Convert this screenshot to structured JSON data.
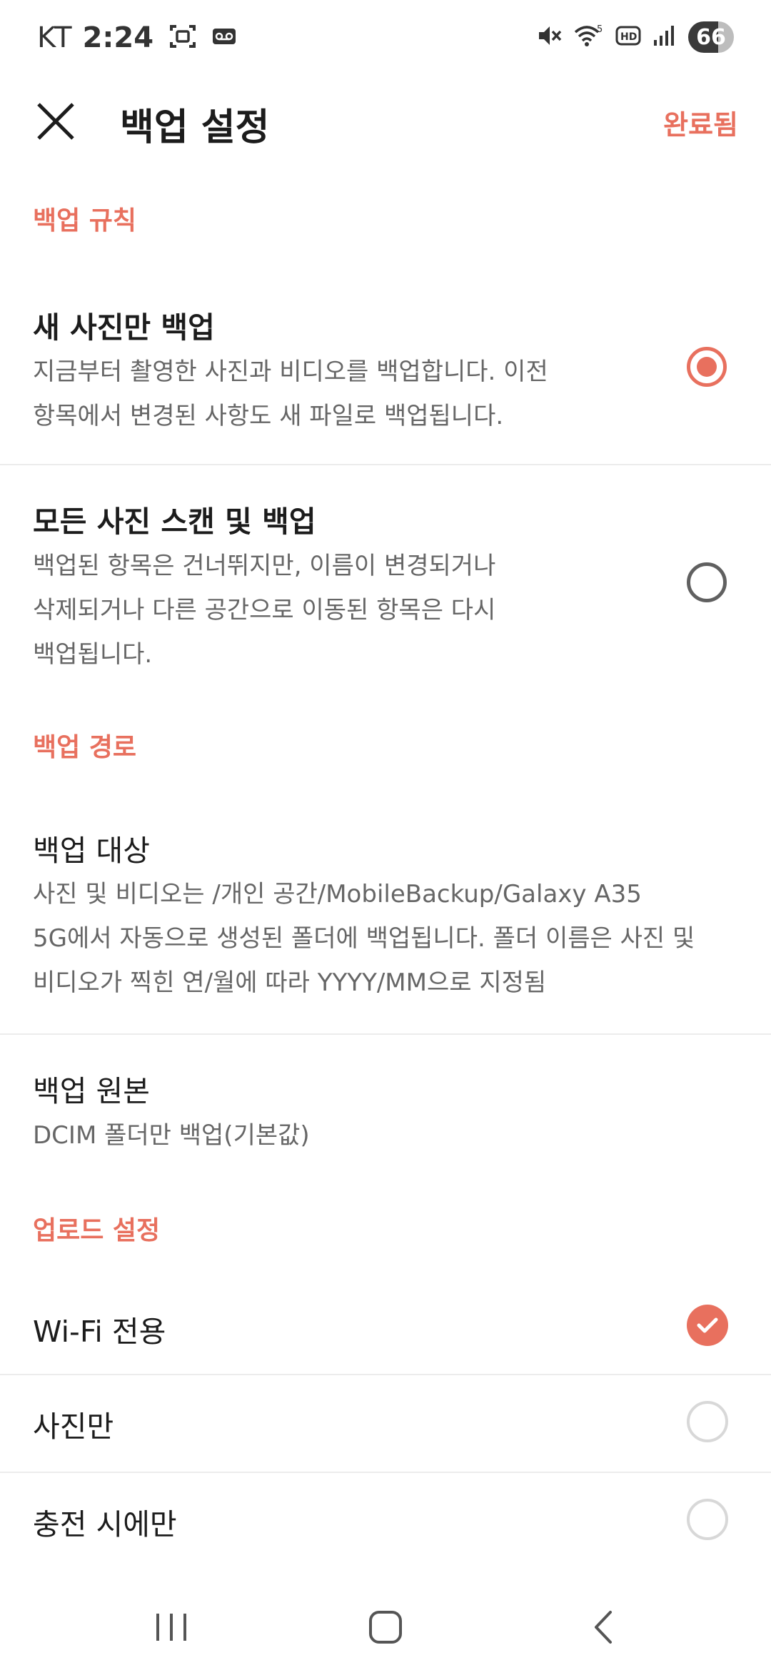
{
  "status_bar": {
    "carrier": "KT",
    "time": "2:24",
    "battery": "66",
    "icons": [
      "screenshot-icon",
      "voicemail-icon",
      "mute-icon",
      "wifi-icon",
      "hd-icon",
      "signal-icon"
    ],
    "wifi_badge": "5"
  },
  "app_bar": {
    "title": "백업 설정",
    "done_label": "완료됨"
  },
  "accent_color": "#e8705e",
  "sections": {
    "rules": {
      "header": "백업 규칙",
      "options": [
        {
          "title": "새 사진만 백업",
          "desc_lines": [
            "지금부터 촬영한 사진과 비디오를 백업합니다. 이전",
            "항목에서 변경된 사항도 새 파일로 백업됩니다."
          ],
          "selected": true
        },
        {
          "title": "모든 사진 스캔 및 백업",
          "desc_lines": [
            "백업된 항목은 건너뛰지만, 이름이 변경되거나",
            "삭제되거나 다른 공간으로 이동된 항목은 다시",
            "백업됩니다."
          ],
          "selected": false
        }
      ]
    },
    "path": {
      "header": "백업 경로",
      "target": {
        "title": "백업 대상",
        "desc_lines": [
          "사진 및 비디오는 /개인 공간/MobileBackup/Galaxy A35",
          "5G에서 자동으로 생성된 폴더에 백업됩니다. 폴더 이름은 사진 및",
          "비디오가 찍힌 연/월에 따라 YYYY/MM으로 지정됨"
        ]
      },
      "source": {
        "title": "백업 원본",
        "value": "DCIM 폴더만 백업(기본값)"
      }
    },
    "upload": {
      "header": "업로드 설정",
      "options": [
        {
          "label": "Wi-Fi 전용",
          "checked": true
        },
        {
          "label": "사진만",
          "checked": false
        },
        {
          "label": "충전 시에만",
          "checked": false
        }
      ]
    }
  },
  "nav_bar": {
    "icons": [
      "recent-apps-icon",
      "home-icon",
      "back-icon"
    ]
  }
}
